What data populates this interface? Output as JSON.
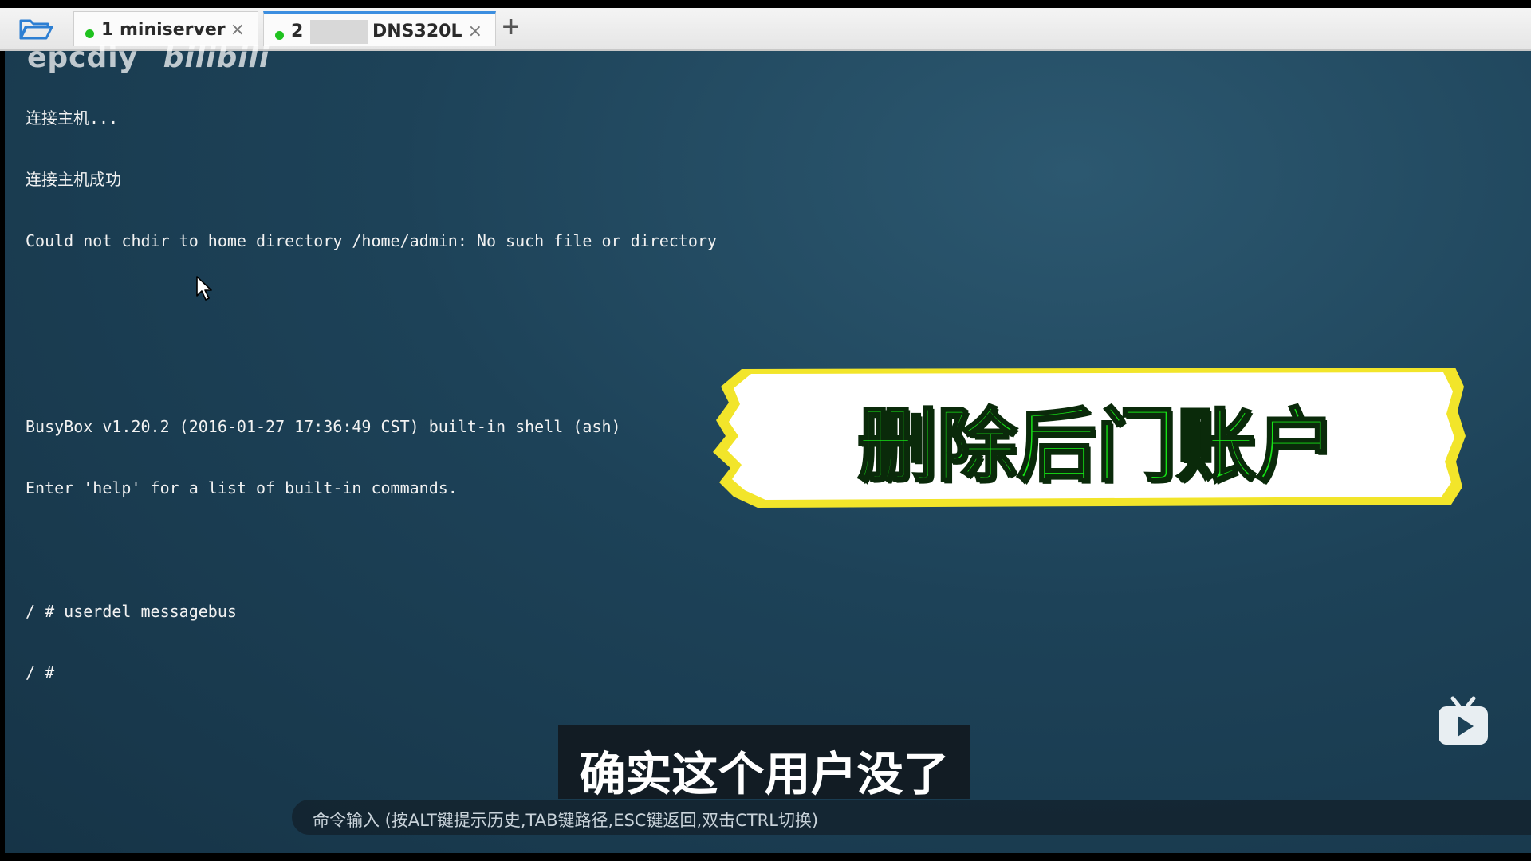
{
  "tabs": [
    {
      "index": "1",
      "name": "miniserver",
      "status_color": "#1fc21f",
      "close": "×"
    },
    {
      "index": "2",
      "name": "DNS320L",
      "status_color": "#1fc21f",
      "close": "×"
    }
  ],
  "add_tab": "+",
  "watermark": {
    "user": "epcdiy",
    "site": "bilibili"
  },
  "terminal": {
    "lines": [
      "连接主机...",
      "连接主机成功",
      "Could not chdir to home directory /home/admin: No such file or directory",
      "",
      "",
      "BusyBox v1.20.2 (2016-01-27 17:36:49 CST) built-in shell (ash)",
      "Enter 'help' for a list of built-in commands.",
      "",
      "/ # userdel messagebus",
      "/ #"
    ]
  },
  "banner": {
    "text": "删除后门账户"
  },
  "subtitle": "确实这个用户没了",
  "command_bar": {
    "hint": "命令输入 (按ALT键提示历史,TAB键路径,ESC键返回,双击CTRL切换)"
  },
  "icons": [
    "folder-open-icon",
    "mouse-cursor-icon",
    "bilibili-tv-icon"
  ]
}
